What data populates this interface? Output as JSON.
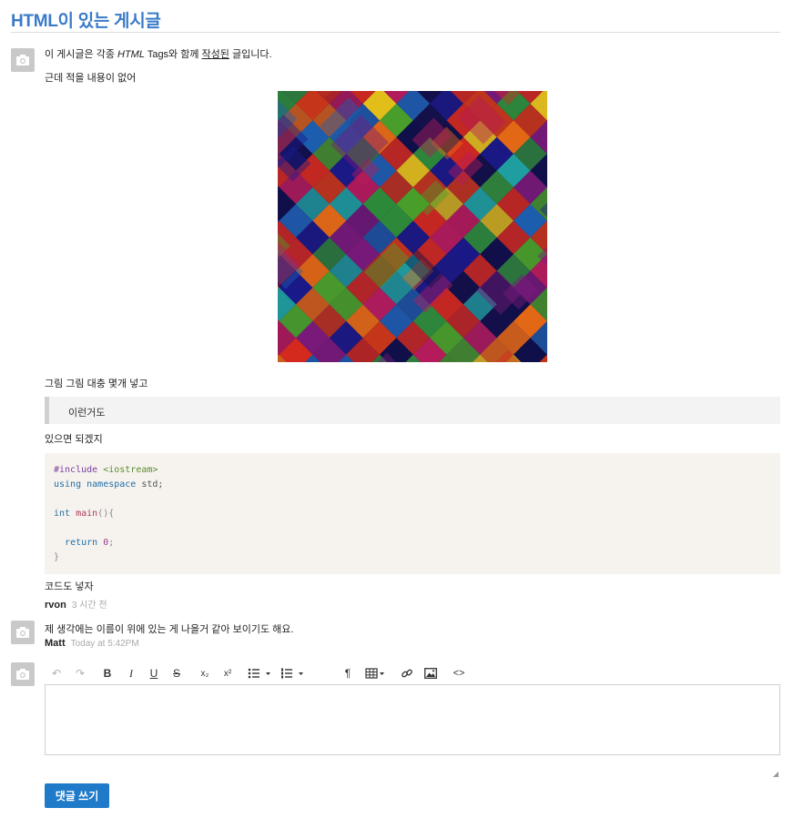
{
  "page": {
    "title": "HTML이 있는 게시글"
  },
  "post": {
    "line1_a": "이 게시글은 각종 ",
    "line1_italic": "HTML",
    "line1_b": " Tags와 함께 ",
    "line1_underline": "작성된",
    "line1_c": " 글입니다.",
    "line2": "근데 적을 내용이 없어",
    "line3": "그림 그림 대충 몇개 넣고",
    "quote": "이런거도",
    "line4": "있으면 되겠지",
    "code": {
      "l1_pre": "#include",
      "l1_str": "<iostream>",
      "l2_kw1": "using",
      "l2_kw2": "namespace",
      "l2_rest": "std;",
      "l4_kw": "int",
      "l4_fn": "main",
      "l4_p": "(){",
      "l6_kw": "return",
      "l6_num": "0",
      "l6_p": ";",
      "l7": "}"
    },
    "line5": "코드도 넣자",
    "author": "rvon",
    "time": "3 시간 전"
  },
  "comment": {
    "text": "제 생각에는 이름이 위에 있는 게 나을거 같아 보이기도 해요.",
    "author": "Matt",
    "time": "Today at 5:42PM"
  },
  "toolbar": {
    "undo": "↶",
    "redo": "↷",
    "bold": "B",
    "italic": "I",
    "underline": "U",
    "strike": "S",
    "subscript": "x₂",
    "superscript": "x²",
    "paragraph": "¶",
    "code": "<>"
  },
  "form": {
    "submit_label": "댓글 쓰기"
  }
}
